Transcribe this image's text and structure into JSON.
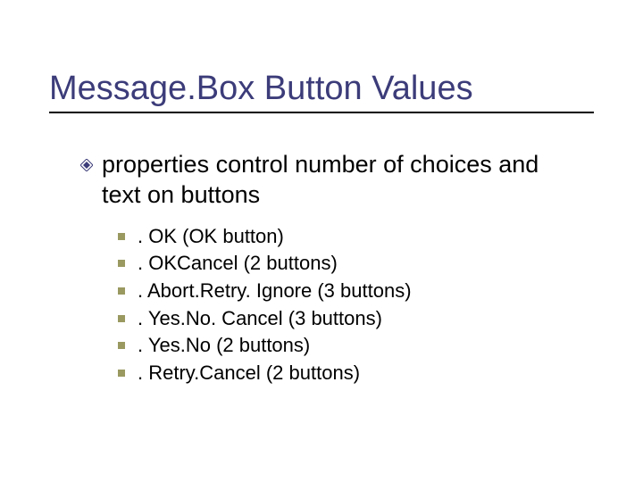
{
  "title": "Message.Box Button Values",
  "intro": "properties control number of choices and text on buttons",
  "items": [
    ". OK (OK button)",
    ". OKCancel (2 buttons)",
    ". Abort.Retry. Ignore (3 buttons)",
    ". Yes.No. Cancel (3 buttons)",
    ". Yes.No (2 buttons)",
    ". Retry.Cancel (2 buttons)"
  ]
}
